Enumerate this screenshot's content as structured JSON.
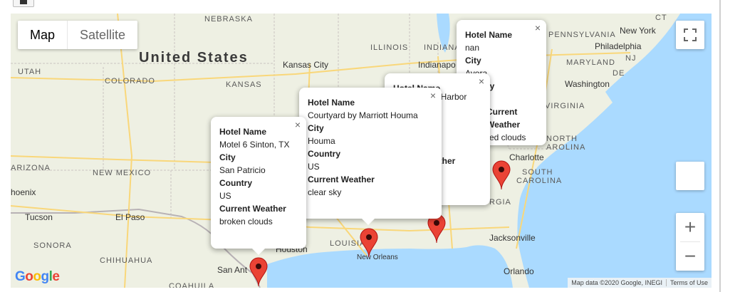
{
  "map_type": {
    "map": "Map",
    "satellite": "Satellite"
  },
  "labels": {
    "nebraska": "NEBRASKA",
    "united_states": "United States",
    "utah": "UTAH",
    "colorado": "COLORADO",
    "kansas": "KANSAS",
    "kansas_city": "Kansas City",
    "illinois": "ILLINOIS",
    "indiana": "INDIANA",
    "indianapolis": "Indianapo",
    "pennsylvania": "PENNSYLVANIA",
    "new_york": "New York",
    "philadelphia": "Philadelphia",
    "maryland": "MARYLAND",
    "de": "DE",
    "nj": "NJ",
    "ct": "CT",
    "washington": "Washington",
    "virginia": "VIRGINIA",
    "north_carolina_1": "NORTH",
    "north_carolina_2": "AROLINA",
    "charlotte": "Charlotte",
    "south_carolina_1": "SOUTH",
    "south_carolina_2": "CAROLINA",
    "georgia": "RGIA",
    "jacksonville": "Jacksonville",
    "orlando": "Orlando",
    "arizona": "ARIZONA",
    "new_mexico": "NEW MEXICO",
    "phoenix": "hoenix",
    "tucson": "Tucson",
    "el_paso": "El Paso",
    "sonora": "SONORA",
    "chihuahua": "CHIHUAHUA",
    "coahuila": "COAHUILA",
    "san_antonio": "San Ant",
    "houston": "Houston",
    "louisiana": "LOUISIA",
    "new_orleans": "New Orleans"
  },
  "info_windows": [
    {
      "close": "×",
      "hotel_label": "Hotel Name",
      "hotel": "Motel 6 Sinton, TX",
      "city_label": "City",
      "city": "San Patricio",
      "country_label": "Country",
      "country": "US",
      "weather_label": "Current Weather",
      "weather": "broken clouds"
    },
    {
      "close": "×",
      "hotel_label": "Hotel Name",
      "hotel": "Courtyard by Marriott Houma",
      "city_label": "City",
      "city": "Houma",
      "country_label": "Country",
      "country": "US",
      "weather_label": "Current Weather",
      "weather": "clear sky"
    },
    {
      "close": "×",
      "hotel_label": "Hotel Name",
      "hotel": "in Harbor",
      "weather_label": "ather"
    },
    {
      "close": "×",
      "hotel_label": "Hotel Name",
      "hotel": "nan",
      "city_label": "City",
      "city": "Avera",
      "country_label": "ry",
      "weather_label": "Current Weather",
      "weather": "red clouds"
    }
  ],
  "zoom": {
    "in": "+",
    "out": "−"
  },
  "branding": {
    "google": "Google"
  },
  "attribution": {
    "data": "Map data ©2020 Google, INEGI",
    "terms": "Terms of Use"
  },
  "colors": {
    "water": "#aadaff",
    "land": "#eef0e3",
    "pin": "#ea4335",
    "highway": "#f9d77a"
  }
}
